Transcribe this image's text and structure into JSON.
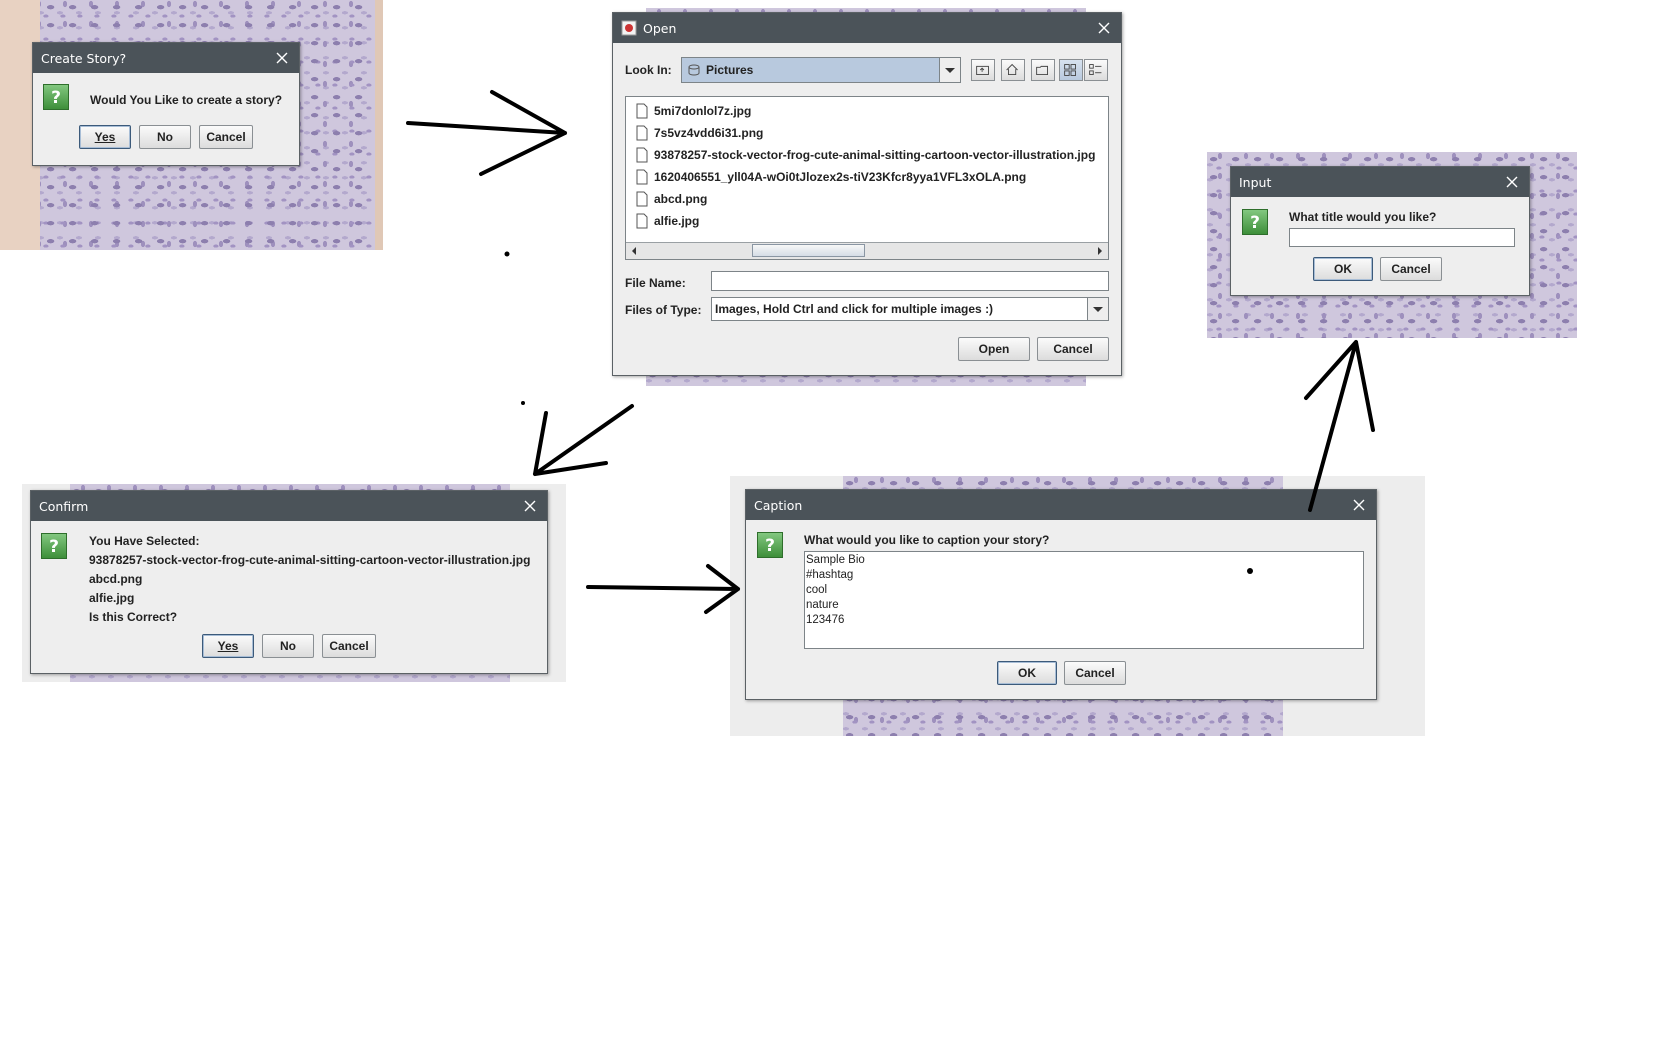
{
  "create_story": {
    "title": "Create Story?",
    "message": "Would You Like to create a story?",
    "buttons": {
      "yes": "Yes",
      "no": "No",
      "cancel": "Cancel"
    }
  },
  "open_dialog": {
    "title": "Open",
    "look_in_label": "Look In:",
    "look_in_value": "Pictures",
    "files": [
      "5mi7donlol7z.jpg",
      "7s5vz4vdd6i31.png",
      "93878257-stock-vector-frog-cute-animal-sitting-cartoon-vector-illustration.jpg",
      "1620406551_yll04A-wOi0tJlozex2s-tiV23Kfcr8yya1VFL3xOLA.png",
      "abcd.png",
      "alfie.jpg"
    ],
    "file_name_label": "File Name:",
    "file_name_value": "",
    "files_of_type_label": "Files of Type:",
    "files_of_type_value": "Images, Hold Ctrl and click for multiple images :)",
    "buttons": {
      "open": "Open",
      "cancel": "Cancel"
    }
  },
  "confirm": {
    "title": "Confirm",
    "lines": [
      "You Have Selected:",
      "93878257-stock-vector-frog-cute-animal-sitting-cartoon-vector-illustration.jpg",
      "abcd.png",
      "alfie.jpg",
      "Is this Correct?"
    ],
    "buttons": {
      "yes": "Yes",
      "no": "No",
      "cancel": "Cancel"
    }
  },
  "caption": {
    "title": "Caption",
    "prompt": "What would you like to caption your story?",
    "text": "Sample Bio\n#hashtag\ncool\nnature\n123476",
    "buttons": {
      "ok": "OK",
      "cancel": "Cancel"
    }
  },
  "input": {
    "title": "Input",
    "prompt": "What title would you like?",
    "value": "",
    "buttons": {
      "ok": "OK",
      "cancel": "Cancel"
    }
  },
  "icons": {
    "question": "question-icon",
    "close": "close-icon",
    "file": "file-icon",
    "drive": "drive-icon"
  },
  "colors": {
    "titlebar": "#4b5359",
    "dialog_bg": "#eeeeee",
    "question_icon": "#4ea34a",
    "combo_selected": "#b8c9de"
  }
}
